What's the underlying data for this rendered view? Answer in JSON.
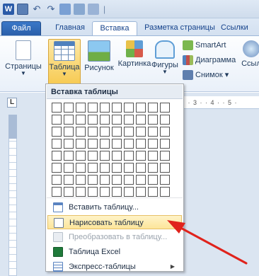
{
  "quick_access": {
    "app_icon_letter": "W",
    "separator": "|"
  },
  "tabs": {
    "file": "Файл",
    "home": "Главная",
    "insert": "Вставка",
    "layout": "Разметка страницы",
    "references": "Ссылки"
  },
  "ribbon": {
    "pages": "Страницы",
    "table": "Таблица",
    "picture": "Рисунок",
    "clipart": "Картинка",
    "shapes": "Фигуры",
    "smartart": "SmartArt",
    "chart": "Диаграмма",
    "screenshot": "Снимок ▾",
    "links": "Ссыл"
  },
  "ruler": {
    "corner": "L",
    "marks": "· · 3 · · 4 · · 5 ·"
  },
  "dropdown": {
    "header": "Вставка таблицы",
    "grid_columns": 10,
    "grid_rows": 8,
    "items": [
      {
        "label": "Вставить таблицу...",
        "icon": "insert-table-icon",
        "state": "normal",
        "submenu": false
      },
      {
        "label": "Нарисовать таблицу",
        "icon": "draw-table-icon",
        "state": "highlighted",
        "submenu": false
      },
      {
        "label": "Преобразовать в таблицу...",
        "icon": "convert-table-icon",
        "state": "disabled",
        "submenu": false
      },
      {
        "label": "Таблица Excel",
        "icon": "excel-icon",
        "state": "normal",
        "submenu": false
      },
      {
        "label": "Экспресс-таблицы",
        "icon": "quick-tables-icon",
        "state": "normal",
        "submenu": true
      }
    ]
  },
  "colors": {
    "accent": "#2a5ea8",
    "highlight": "#fde59a",
    "annotation_arrow": "#e0231c"
  }
}
